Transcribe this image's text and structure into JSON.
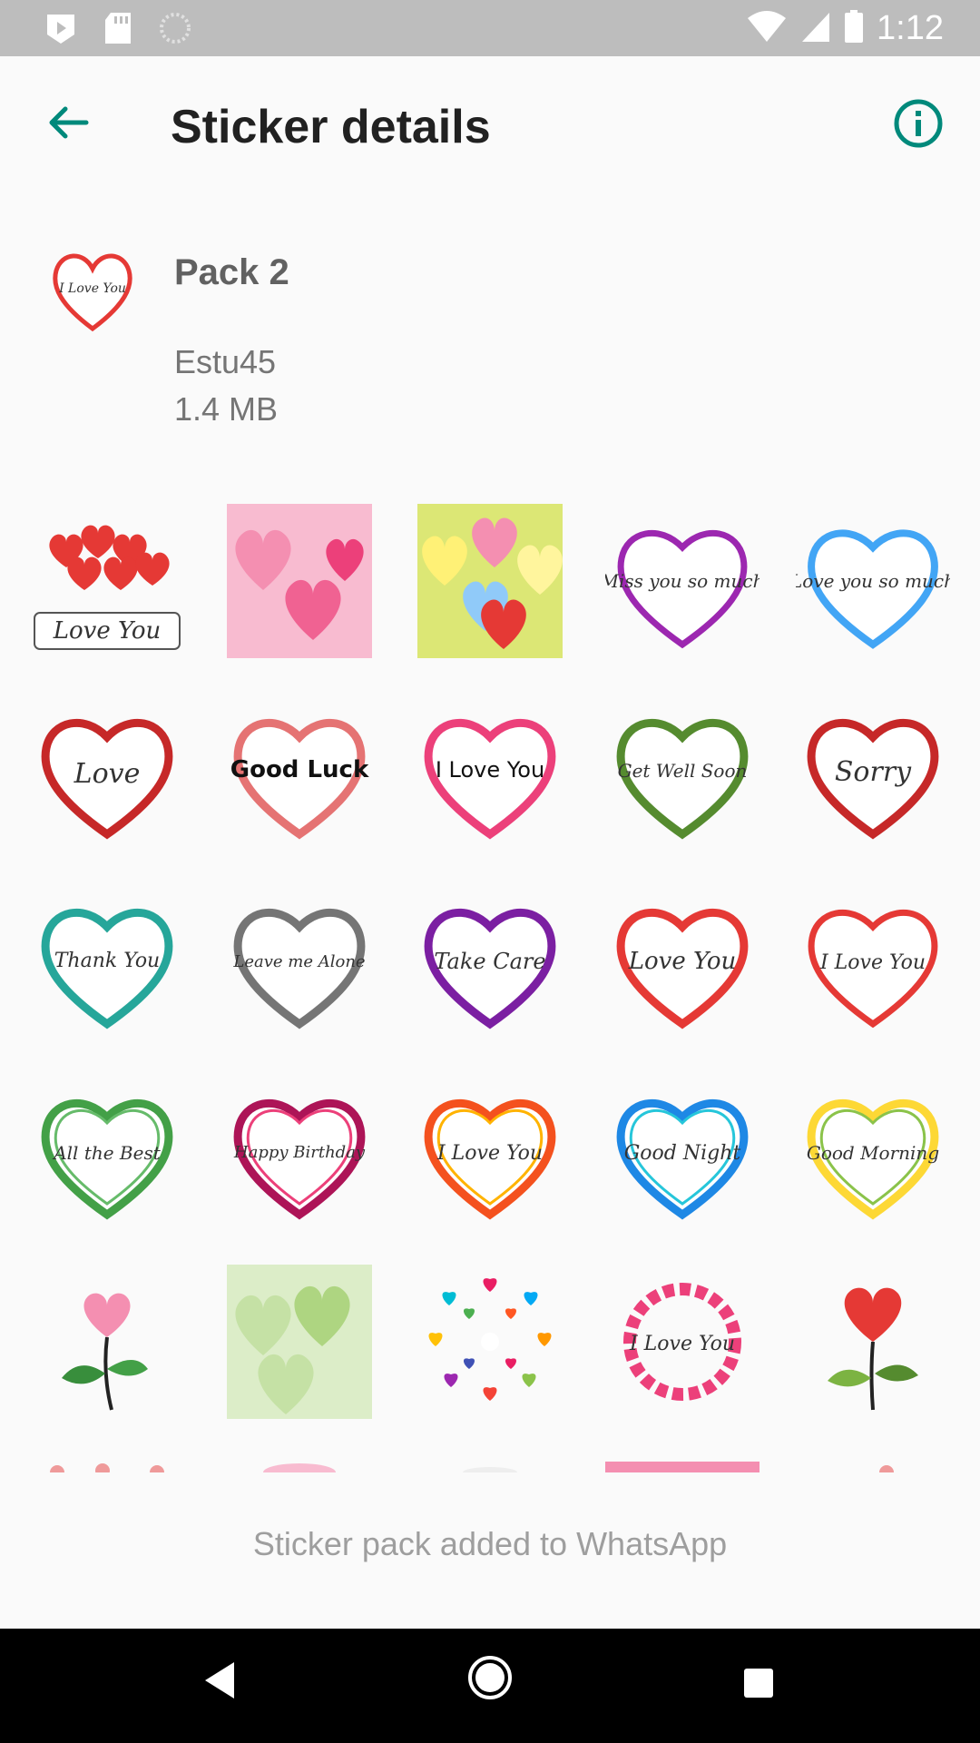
{
  "status_bar": {
    "time": "1:12",
    "icons": [
      "play-store-icon",
      "sd-card-icon",
      "loading-icon",
      "wifi-icon",
      "signal-icon",
      "battery-icon"
    ]
  },
  "app_bar": {
    "title": "Sticker details",
    "back_icon": "arrow-back-icon",
    "info_icon": "info-icon"
  },
  "pack": {
    "name": "Pack 2",
    "publisher": "Estu45",
    "size": "1.4 MB",
    "tray_text": "I Love You"
  },
  "stickers": [
    {
      "text": "Love You"
    },
    {
      "text": ""
    },
    {
      "text": ""
    },
    {
      "text": "Miss you so much"
    },
    {
      "text": "Love you so much"
    },
    {
      "text": "Love"
    },
    {
      "text": "Good Luck"
    },
    {
      "text": "I Love You"
    },
    {
      "text": "Get Well Soon"
    },
    {
      "text": "Sorry"
    },
    {
      "text": "Thank You"
    },
    {
      "text": "Leave me Alone"
    },
    {
      "text": "Take Care"
    },
    {
      "text": "Love You"
    },
    {
      "text": "I Love You"
    },
    {
      "text": "All the Best"
    },
    {
      "text": "Happy Birthday"
    },
    {
      "text": "I Love You"
    },
    {
      "text": "Good Night"
    },
    {
      "text": "Good Morning"
    },
    {
      "text": ""
    },
    {
      "text": ""
    },
    {
      "text": ""
    },
    {
      "text": "I Love You"
    },
    {
      "text": ""
    }
  ],
  "footer": {
    "status": "Sticker pack added to WhatsApp"
  },
  "nav_bar": {
    "icons": [
      "nav-back-icon",
      "nav-home-icon",
      "nav-recents-icon"
    ]
  }
}
